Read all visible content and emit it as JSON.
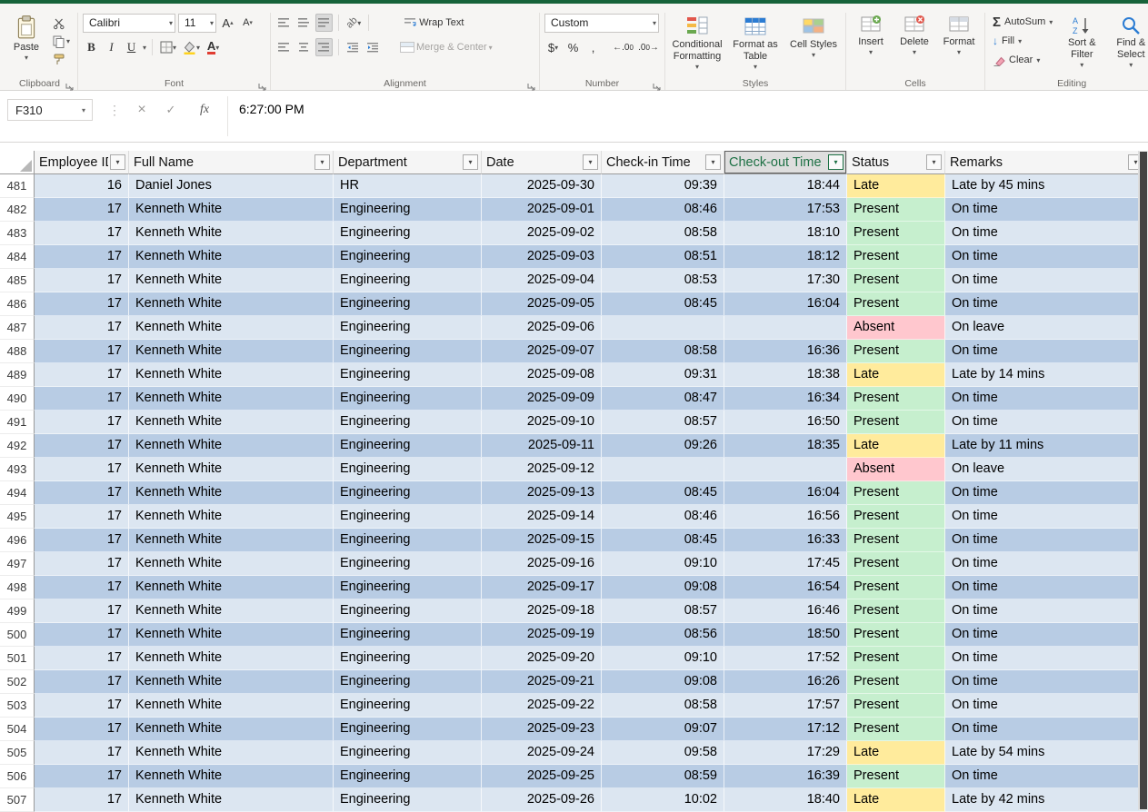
{
  "ribbon": {
    "clipboard": {
      "label": "Clipboard",
      "paste": "Paste"
    },
    "font": {
      "label": "Font",
      "font_name": "Calibri",
      "font_size": "11",
      "bold": "B",
      "italic": "I",
      "underline": "U"
    },
    "alignment": {
      "label": "Alignment",
      "wrap_text": "Wrap Text",
      "merge_center": "Merge & Center"
    },
    "number": {
      "label": "Number",
      "format": "Custom",
      "currency": "$",
      "percent": "%",
      "comma": ","
    },
    "styles": {
      "label": "Styles",
      "conditional": "Conditional Formatting",
      "format_table": "Format as Table",
      "cell_styles": "Cell Styles"
    },
    "cells": {
      "label": "Cells",
      "insert": "Insert",
      "delete": "Delete",
      "format": "Format"
    },
    "editing": {
      "label": "Editing",
      "autosum": "AutoSum",
      "fill": "Fill",
      "clear": "Clear",
      "sort_filter": "Sort & Filter",
      "find_select": "Find & Select"
    }
  },
  "formula_bar": {
    "name_box": "F310",
    "value": "6:27:00 PM"
  },
  "table": {
    "columns": [
      "Employee ID",
      "Full Name",
      "Department",
      "Date",
      "Check-in Time",
      "Check-out Time",
      "Status",
      "Remarks"
    ],
    "selected_column_index": 5,
    "rows": [
      [
        481,
        "16",
        "Daniel Jones",
        "HR",
        "2025-09-30",
        "09:39",
        "18:44",
        "Late",
        "Late by 45 mins"
      ],
      [
        482,
        "17",
        "Kenneth White",
        "Engineering",
        "2025-09-01",
        "08:46",
        "17:53",
        "Present",
        "On time"
      ],
      [
        483,
        "17",
        "Kenneth White",
        "Engineering",
        "2025-09-02",
        "08:58",
        "18:10",
        "Present",
        "On time"
      ],
      [
        484,
        "17",
        "Kenneth White",
        "Engineering",
        "2025-09-03",
        "08:51",
        "18:12",
        "Present",
        "On time"
      ],
      [
        485,
        "17",
        "Kenneth White",
        "Engineering",
        "2025-09-04",
        "08:53",
        "17:30",
        "Present",
        "On time"
      ],
      [
        486,
        "17",
        "Kenneth White",
        "Engineering",
        "2025-09-05",
        "08:45",
        "16:04",
        "Present",
        "On time"
      ],
      [
        487,
        "17",
        "Kenneth White",
        "Engineering",
        "2025-09-06",
        "",
        "",
        "Absent",
        "On leave"
      ],
      [
        488,
        "17",
        "Kenneth White",
        "Engineering",
        "2025-09-07",
        "08:58",
        "16:36",
        "Present",
        "On time"
      ],
      [
        489,
        "17",
        "Kenneth White",
        "Engineering",
        "2025-09-08",
        "09:31",
        "18:38",
        "Late",
        "Late by 14 mins"
      ],
      [
        490,
        "17",
        "Kenneth White",
        "Engineering",
        "2025-09-09",
        "08:47",
        "16:34",
        "Present",
        "On time"
      ],
      [
        491,
        "17",
        "Kenneth White",
        "Engineering",
        "2025-09-10",
        "08:57",
        "16:50",
        "Present",
        "On time"
      ],
      [
        492,
        "17",
        "Kenneth White",
        "Engineering",
        "2025-09-11",
        "09:26",
        "18:35",
        "Late",
        "Late by 11 mins"
      ],
      [
        493,
        "17",
        "Kenneth White",
        "Engineering",
        "2025-09-12",
        "",
        "",
        "Absent",
        "On leave"
      ],
      [
        494,
        "17",
        "Kenneth White",
        "Engineering",
        "2025-09-13",
        "08:45",
        "16:04",
        "Present",
        "On time"
      ],
      [
        495,
        "17",
        "Kenneth White",
        "Engineering",
        "2025-09-14",
        "08:46",
        "16:56",
        "Present",
        "On time"
      ],
      [
        496,
        "17",
        "Kenneth White",
        "Engineering",
        "2025-09-15",
        "08:45",
        "16:33",
        "Present",
        "On time"
      ],
      [
        497,
        "17",
        "Kenneth White",
        "Engineering",
        "2025-09-16",
        "09:10",
        "17:45",
        "Present",
        "On time"
      ],
      [
        498,
        "17",
        "Kenneth White",
        "Engineering",
        "2025-09-17",
        "09:08",
        "16:54",
        "Present",
        "On time"
      ],
      [
        499,
        "17",
        "Kenneth White",
        "Engineering",
        "2025-09-18",
        "08:57",
        "16:46",
        "Present",
        "On time"
      ],
      [
        500,
        "17",
        "Kenneth White",
        "Engineering",
        "2025-09-19",
        "08:56",
        "18:50",
        "Present",
        "On time"
      ],
      [
        501,
        "17",
        "Kenneth White",
        "Engineering",
        "2025-09-20",
        "09:10",
        "17:52",
        "Present",
        "On time"
      ],
      [
        502,
        "17",
        "Kenneth White",
        "Engineering",
        "2025-09-21",
        "09:08",
        "16:26",
        "Present",
        "On time"
      ],
      [
        503,
        "17",
        "Kenneth White",
        "Engineering",
        "2025-09-22",
        "08:58",
        "17:57",
        "Present",
        "On time"
      ],
      [
        504,
        "17",
        "Kenneth White",
        "Engineering",
        "2025-09-23",
        "09:07",
        "17:12",
        "Present",
        "On time"
      ],
      [
        505,
        "17",
        "Kenneth White",
        "Engineering",
        "2025-09-24",
        "09:58",
        "17:29",
        "Late",
        "Late by 54 mins"
      ],
      [
        506,
        "17",
        "Kenneth White",
        "Engineering",
        "2025-09-25",
        "08:59",
        "16:39",
        "Present",
        "On time"
      ],
      [
        507,
        "17",
        "Kenneth White",
        "Engineering",
        "2025-09-26",
        "10:02",
        "18:40",
        "Late",
        "Late by 42 mins"
      ]
    ]
  },
  "colors": {
    "accent_green": "#1d7044",
    "band_light": "#dce6f1",
    "band_dark": "#b8cce4",
    "status": {
      "Present": "#c6efce",
      "Late": "#ffeb9c",
      "Absent": "#ffc7ce"
    }
  }
}
